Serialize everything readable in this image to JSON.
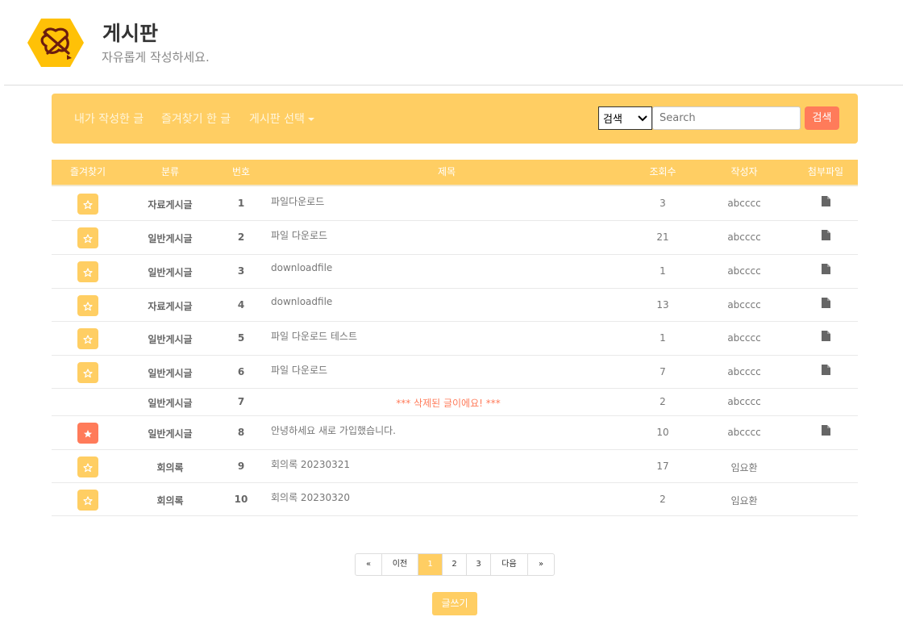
{
  "header": {
    "title": "게시판",
    "subtitle": "자유롭게 작성하세요."
  },
  "toolbar": {
    "my_posts": "내가 작성한 글",
    "favorites": "즐겨찾기 한 글",
    "board_select": "게시판 선택",
    "search_option": "검색",
    "search_placeholder": "Search",
    "search_button": "검색"
  },
  "table": {
    "headers": [
      "즐겨찾기",
      "분류",
      "번호",
      "제목",
      "조회수",
      "작성자",
      "첨부파일"
    ],
    "rows": [
      {
        "favorite": false,
        "category": "자료게시글",
        "number": "1",
        "title": "파일다운로드",
        "views": "3",
        "author": "abcccc",
        "attachment": true,
        "deleted": false
      },
      {
        "favorite": false,
        "category": "일반게시글",
        "number": "2",
        "title": "파일 다운로드",
        "views": "21",
        "author": "abcccc",
        "attachment": true,
        "deleted": false
      },
      {
        "favorite": false,
        "category": "일반게시글",
        "number": "3",
        "title": "downloadfile",
        "views": "1",
        "author": "abcccc",
        "attachment": true,
        "deleted": false
      },
      {
        "favorite": false,
        "category": "자료게시글",
        "number": "4",
        "title": "downloadfile",
        "views": "13",
        "author": "abcccc",
        "attachment": true,
        "deleted": false
      },
      {
        "favorite": false,
        "category": "일반게시글",
        "number": "5",
        "title": "파일 다운로드 테스트",
        "views": "1",
        "author": "abcccc",
        "attachment": true,
        "deleted": false
      },
      {
        "favorite": false,
        "category": "일반게시글",
        "number": "6",
        "title": "파일 다운로드",
        "views": "7",
        "author": "abcccc",
        "attachment": true,
        "deleted": false
      },
      {
        "favorite": null,
        "category": "일반게시글",
        "number": "7",
        "title": "*** 삭제된 글이에요! ***",
        "views": "2",
        "author": "abcccc",
        "attachment": false,
        "deleted": true
      },
      {
        "favorite": true,
        "category": "일반게시글",
        "number": "8",
        "title": "안녕하세요 새로 가입했습니다.",
        "views": "10",
        "author": "abcccc",
        "attachment": true,
        "deleted": false
      },
      {
        "favorite": false,
        "category": "회의록",
        "number": "9",
        "title": "회의록 20230321",
        "views": "17",
        "author": "임요환",
        "attachment": false,
        "deleted": false
      },
      {
        "favorite": false,
        "category": "회의록",
        "number": "10",
        "title": "회의록 20230320",
        "views": "2",
        "author": "임요환",
        "attachment": false,
        "deleted": false
      }
    ]
  },
  "pagination": {
    "first": "«",
    "prev": "이전",
    "pages": [
      "1",
      "2",
      "3"
    ],
    "active_page": "1",
    "next": "다음",
    "last": "»"
  },
  "write_button": "글쓰기",
  "colors": {
    "accent": "#ffce63",
    "danger": "#ff7b5a"
  },
  "icons": {
    "favorite_off": "star-outline-icon",
    "favorite_on": "star-filled-icon",
    "attachment": "file-icon",
    "logo": "no-pen-hexagon-logo"
  }
}
